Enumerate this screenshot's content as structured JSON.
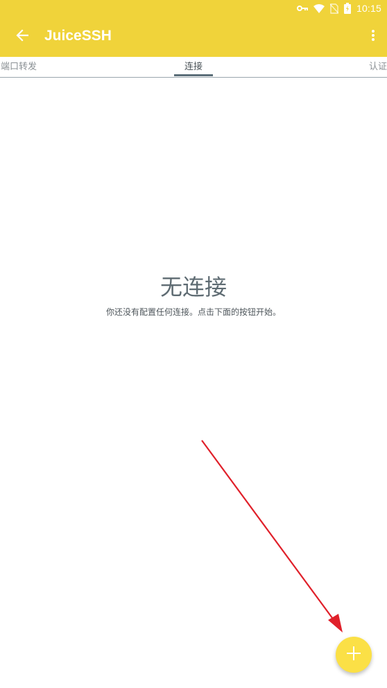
{
  "status_bar": {
    "time": "10:15",
    "icons": [
      "vpn-key-icon",
      "wifi-icon",
      "no-sim-icon",
      "battery-icon"
    ]
  },
  "toolbar": {
    "title": "JuiceSSH",
    "back_icon": "arrow-back-icon",
    "menu_icon": "more-vert-icon"
  },
  "tabs": {
    "left_label": "端口转发",
    "center_label": "连接",
    "right_label": "认证",
    "selected": "连接"
  },
  "empty_state": {
    "title": "无连接",
    "subtitle": "你还没有配置任何连接。点击下面的按钮开始。"
  },
  "fab": {
    "icon": "plus-icon"
  },
  "colors": {
    "header": "#F0D33A",
    "fab": "#FBE046",
    "annotation_arrow": "#E0202A"
  }
}
